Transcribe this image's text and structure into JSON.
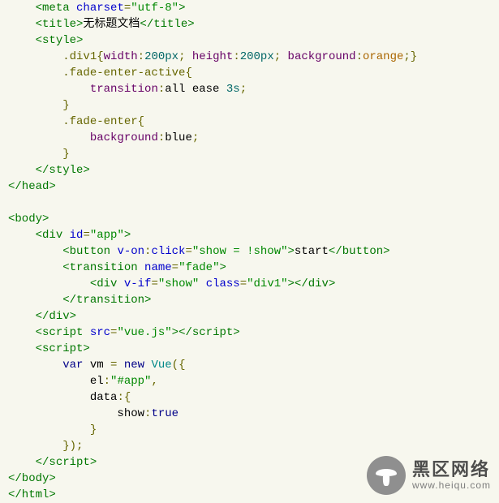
{
  "code": {
    "l01": {
      "tag1": "<meta",
      "a1": "charset",
      "p1": "=",
      "v1": "\"utf-8\"",
      "tag2": ">"
    },
    "l02": {
      "tag1": "<title>",
      "txt": "无标题文档",
      "tag2": "</title>"
    },
    "l03": {
      "tag1": "<style>"
    },
    "l04": {
      "sel": ".div1",
      "b1": "{",
      "p1": "width",
      "c1": ":",
      "n1": "200px",
      "s1": ";",
      "p2": "height",
      "c2": ":",
      "n2": "200px",
      "s2": ";",
      "p3": "background",
      "c3": ":",
      "v3": "orange",
      "s3": ";",
      "b2": "}"
    },
    "l05": {
      "sel": ".fade-enter-active",
      "b1": "{"
    },
    "l06": {
      "p1": "transition",
      "c1": ":",
      "v1": "all ease ",
      "n1": "3s",
      "s1": ";"
    },
    "l07": {
      "b1": "}"
    },
    "l08": {
      "sel": ".fade-enter",
      "b1": "{"
    },
    "l09": {
      "p1": "background",
      "c1": ":",
      "v1": "blue",
      "s1": ";"
    },
    "l10": {
      "b1": "}"
    },
    "l11": {
      "tag1": "</style>"
    },
    "l12": {
      "tag1": "</head>"
    },
    "l13": {
      "tag1": "<body>"
    },
    "l14": {
      "tag1": "<div",
      "a1": "id",
      "p1": "=",
      "v1": "\"app\"",
      "tag2": ">"
    },
    "l15": {
      "tag1": "<button",
      "a1": "v-on",
      "p1": ":",
      "a2": "click",
      "p2": "=",
      "v1": "\"show = !show\"",
      "tag2": ">",
      "txt": "start",
      "tag3": "</button>"
    },
    "l16": {
      "tag1": "<transition",
      "a1": "name",
      "p1": "=",
      "v1": "\"fade\"",
      "tag2": ">"
    },
    "l17": {
      "tag1": "<div",
      "a1": "v-if",
      "p1": "=",
      "v1": "\"show\"",
      "a2": "class",
      "p2": "=",
      "v2": "\"div1\"",
      "tag2": "></div>"
    },
    "l18": {
      "tag1": "</transition>"
    },
    "l19": {
      "tag1": "</div>"
    },
    "l20": {
      "tag1": "<script",
      "a1": "src",
      "p1": "=",
      "v1": "\"vue.js\"",
      "tag2": ">",
      "tag3": "</script>"
    },
    "l21": {
      "tag1": "<script>"
    },
    "l22": {
      "kw1": "var",
      "id1": " vm ",
      "op1": "=",
      "kw2": " new",
      "fn": " Vue",
      "p1": "({"
    },
    "l23": {
      "id1": "el",
      "op1": ":",
      "v1": "\"#app\"",
      "p1": ","
    },
    "l24": {
      "id1": "data",
      "op1": ":",
      "p1": "{"
    },
    "l25": {
      "id1": "show",
      "op1": ":",
      "b1": "true"
    },
    "l26": {
      "p1": "}"
    },
    "l27": {
      "p1": "});"
    },
    "l28": {
      "tag1": "</script>"
    },
    "l29": {
      "tag1": "</body>"
    },
    "l30": {
      "tag1": "</html>"
    }
  },
  "watermark": {
    "cn": "黑区网络",
    "en": "www.heiqu.com"
  }
}
